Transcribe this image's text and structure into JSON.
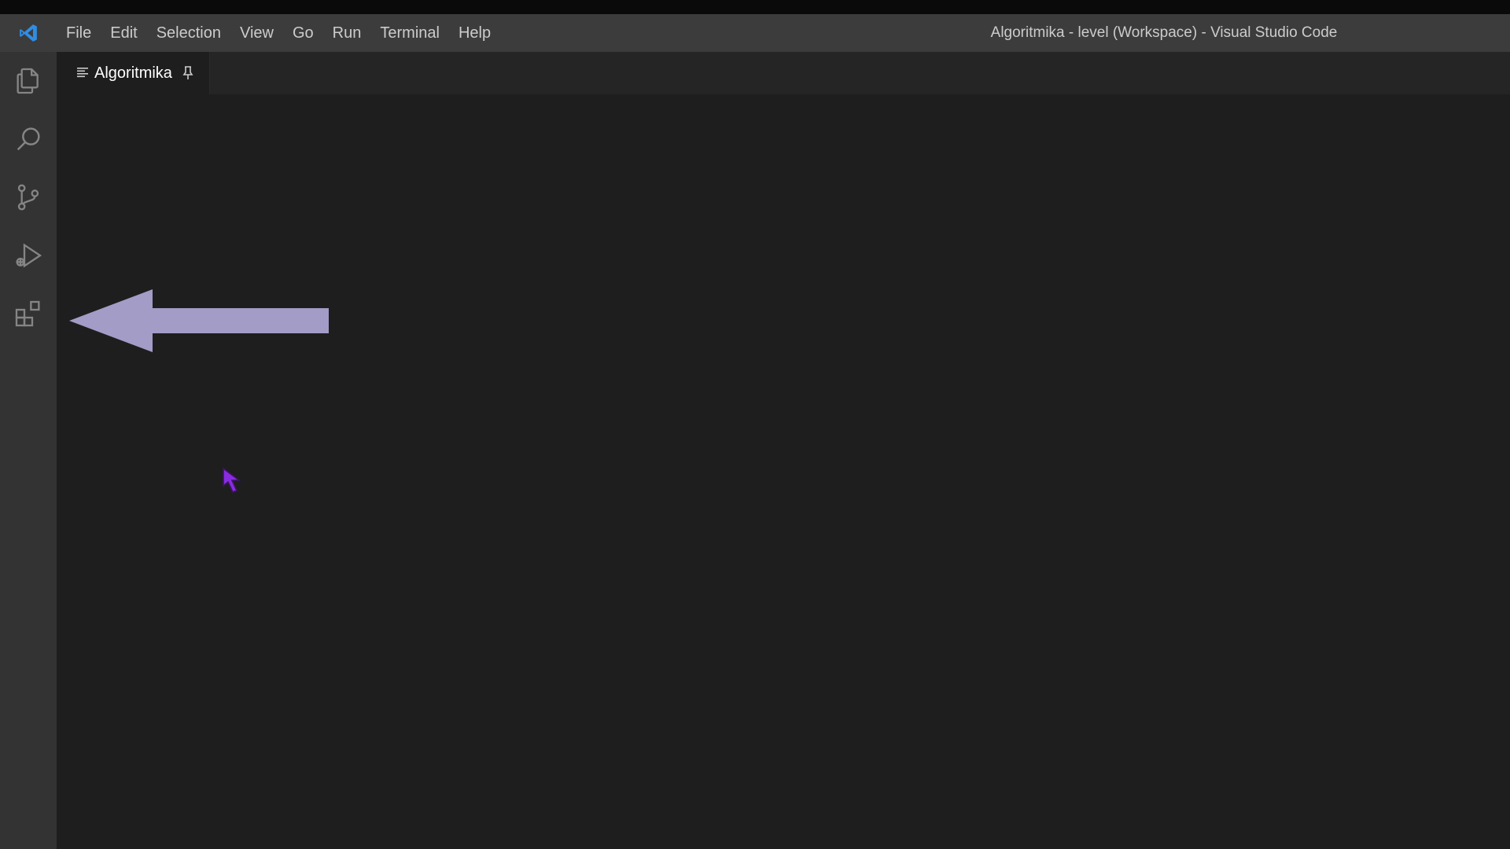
{
  "window": {
    "title": "Algoritmika - level (Workspace) - Visual Studio Code"
  },
  "menu": {
    "items": [
      "File",
      "Edit",
      "Selection",
      "View",
      "Go",
      "Run",
      "Terminal",
      "Help"
    ]
  },
  "activity_bar": {
    "icons": [
      "explorer-icon",
      "search-icon",
      "source-control-icon",
      "run-debug-icon",
      "extensions-icon"
    ]
  },
  "tabs": [
    {
      "label": "Algoritmika",
      "icon": "preview-lines-icon",
      "pinned": true
    }
  ],
  "colors": {
    "titlebar": "#3c3c3c",
    "activitybar": "#333333",
    "editor": "#1e1e1e",
    "arrow": "#a39cc6",
    "cursor": "#8a2be2",
    "vscode_blue": "#2f8de4"
  }
}
